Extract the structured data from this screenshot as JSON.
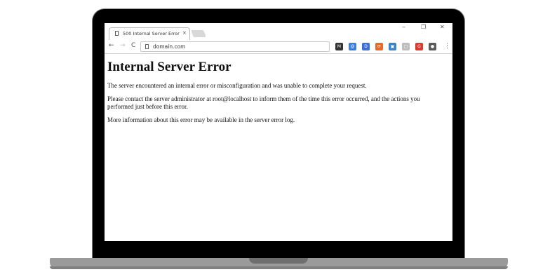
{
  "browser": {
    "tab_title": "500 Internal Server Error",
    "tab_close": "×",
    "url": "domain.com",
    "window_controls": {
      "minimize": "‒",
      "restore": "❐",
      "close": "✕"
    },
    "nav": {
      "back": "←",
      "forward": "→",
      "reload": "C"
    },
    "extensions": [
      {
        "name": "gmail-extension-icon",
        "glyph": "M",
        "color": "#333333"
      },
      {
        "name": "blue-circle-extension-icon",
        "glyph": "@",
        "color": "#3b7ddd"
      },
      {
        "name": "blue-d-extension-icon",
        "glyph": "D",
        "color": "#3b6fd1"
      },
      {
        "name": "orange-extension-icon",
        "glyph": "⟳",
        "color": "#e8692d"
      },
      {
        "name": "blue-square-extension-icon",
        "glyph": "▣",
        "color": "#3a84c9"
      },
      {
        "name": "gray-extension-icon",
        "glyph": "□",
        "color": "#bdbdbd"
      },
      {
        "name": "red-g-extension-icon",
        "glyph": "G",
        "color": "#d93b31"
      },
      {
        "name": "dark-circle-extension-icon",
        "glyph": "●",
        "color": "#5a5a5a"
      }
    ],
    "menu": "⋮"
  },
  "page": {
    "heading": "Internal Server Error",
    "paragraphs": [
      "The server encountered an internal error or misconfiguration and was unable to complete your request.",
      "Please contact the server administrator at root@localhost to inform them of the time this error occurred, and the actions you performed just before this error.",
      "More information about this error may be available in the server error log."
    ]
  }
}
